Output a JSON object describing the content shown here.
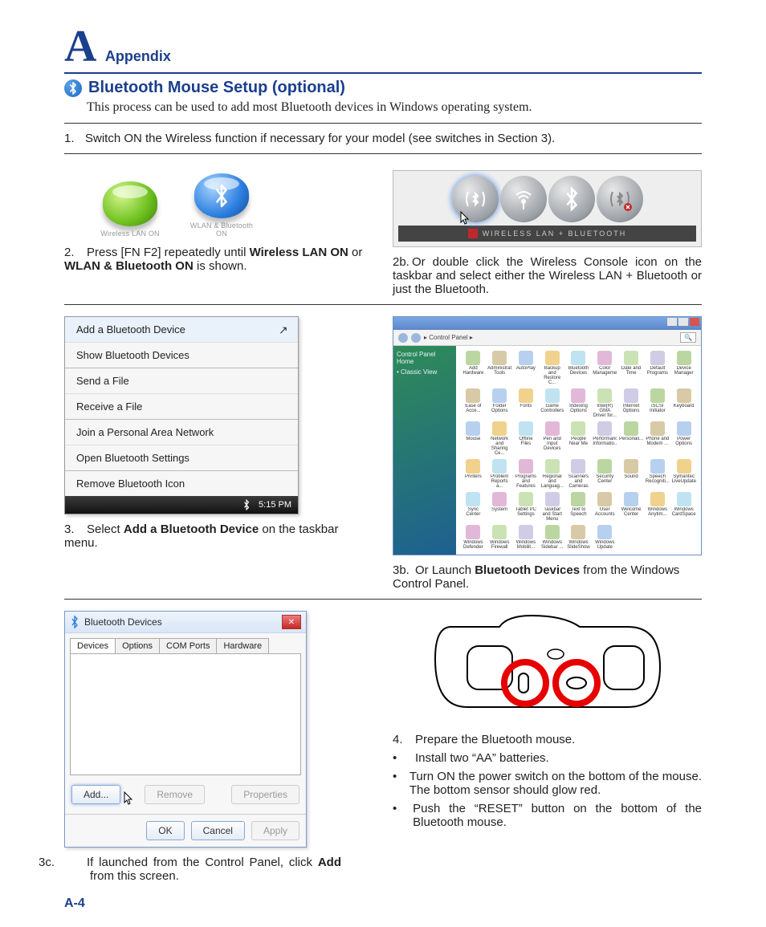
{
  "header": {
    "letter": "A",
    "label": "Appendix"
  },
  "section": {
    "icon": "bluetooth-icon",
    "title": "Bluetooth Mouse Setup (optional)",
    "intro": "This process can be used to add most Bluetooth devices in Windows operating system."
  },
  "step1": {
    "num": "1.",
    "text": "Switch ON the Wireless function if necessary for your model (see switches in Section 3)."
  },
  "osd": {
    "left_caption": "Wireless LAN ON",
    "right_caption": "WLAN & Bluetooth ON"
  },
  "step2": {
    "num": "2.",
    "pre": "Press [FN F2] repeatedly until ",
    "bold1": "Wireless LAN ON",
    "mid": " or ",
    "bold2": "WLAN & Bluetooth ON",
    "post": " is shown."
  },
  "wireless_console": {
    "label": "WIRELESS LAN + BLUETOOTH"
  },
  "step2b": {
    "num": "2b.",
    "text": "Or double click the Wireless Console icon on the taskbar and select either the Wireless LAN + Bluetooth or just the Bluetooth."
  },
  "context_menu": {
    "items": [
      "Add a Bluetooth Device",
      "Show Bluetooth Devices",
      "Send a File",
      "Receive a File",
      "Join a Personal Area Network",
      "Open Bluetooth Settings",
      "Remove Bluetooth Icon"
    ],
    "tray_time": "5:15 PM"
  },
  "step3": {
    "num": "3.",
    "pre": "Select ",
    "bold": "Add a Bluetooth Device",
    "post": " on the taskbar menu."
  },
  "control_panel": {
    "breadcrumb": "▸ Control Panel ▸",
    "search_placeholder": "Search",
    "side": [
      "Control Panel Home",
      "• Classic View"
    ],
    "icons": [
      "Add Hardware",
      "Administrat... Tools",
      "AutoPlay",
      "Backup and Restore C...",
      "Bluetooth Devices",
      "Color Management",
      "Date and Time",
      "Default Programs",
      "Device Manager",
      "Ease of Acce...",
      "Folder Options",
      "Fonts",
      "Game Controllers",
      "Indexing Options",
      "Intel(R) GMA Driver for...",
      "Internet Options",
      "iSCSI Initiator",
      "Keyboard",
      "Mouse",
      "Network and Sharing Ce...",
      "Offline Files",
      "Pen and Input Devices",
      "People Near Me",
      "Performance Informatio...",
      "Personali...",
      "Phone and Modem ...",
      "Power Options",
      "Printers",
      "Problem Reports a...",
      "Programs and Features",
      "Regional and Languag...",
      "Scanners and Cameras",
      "Security Center",
      "Sound",
      "Speech Recogniti...",
      "Symantec LiveUpdate",
      "Sync Center",
      "System",
      "Tablet PC Settings",
      "Taskbar and Start Menu",
      "Text to Speech",
      "User Accounts",
      "Welcome Center",
      "Windows Anytim...",
      "Windows CardSpace",
      "Windows Defender",
      "Windows Firewall",
      "Windows Mobilit...",
      "Windows Sidebar ...",
      "Windows SlideShow",
      "Windows Update"
    ]
  },
  "step3b": {
    "num": "3b.",
    "pre": "Or Launch ",
    "bold": "Bluetooth Devices",
    "post": " from the Windows Control Panel."
  },
  "bt_dialog": {
    "title": "Bluetooth Devices",
    "tabs": [
      "Devices",
      "Options",
      "COM Ports",
      "Hardware"
    ],
    "buttons": {
      "add": "Add...",
      "remove": "Remove",
      "properties": "Properties",
      "ok": "OK",
      "cancel": "Cancel",
      "apply": "Apply"
    }
  },
  "step3c": {
    "num": "3c.",
    "pre": "If launched from the Control Panel, click ",
    "bold": "Add",
    "post": " from this screen."
  },
  "step4": {
    "num": "4.",
    "text": "Prepare the Bluetooth mouse.",
    "bullets": [
      "Install two “AA” batteries.",
      "Turn ON the power switch on the bottom of the mouse. The bottom sensor should glow red.",
      "Push the “RESET” button on the bottom of the Bluetooth mouse."
    ]
  },
  "page_number": "A-4"
}
